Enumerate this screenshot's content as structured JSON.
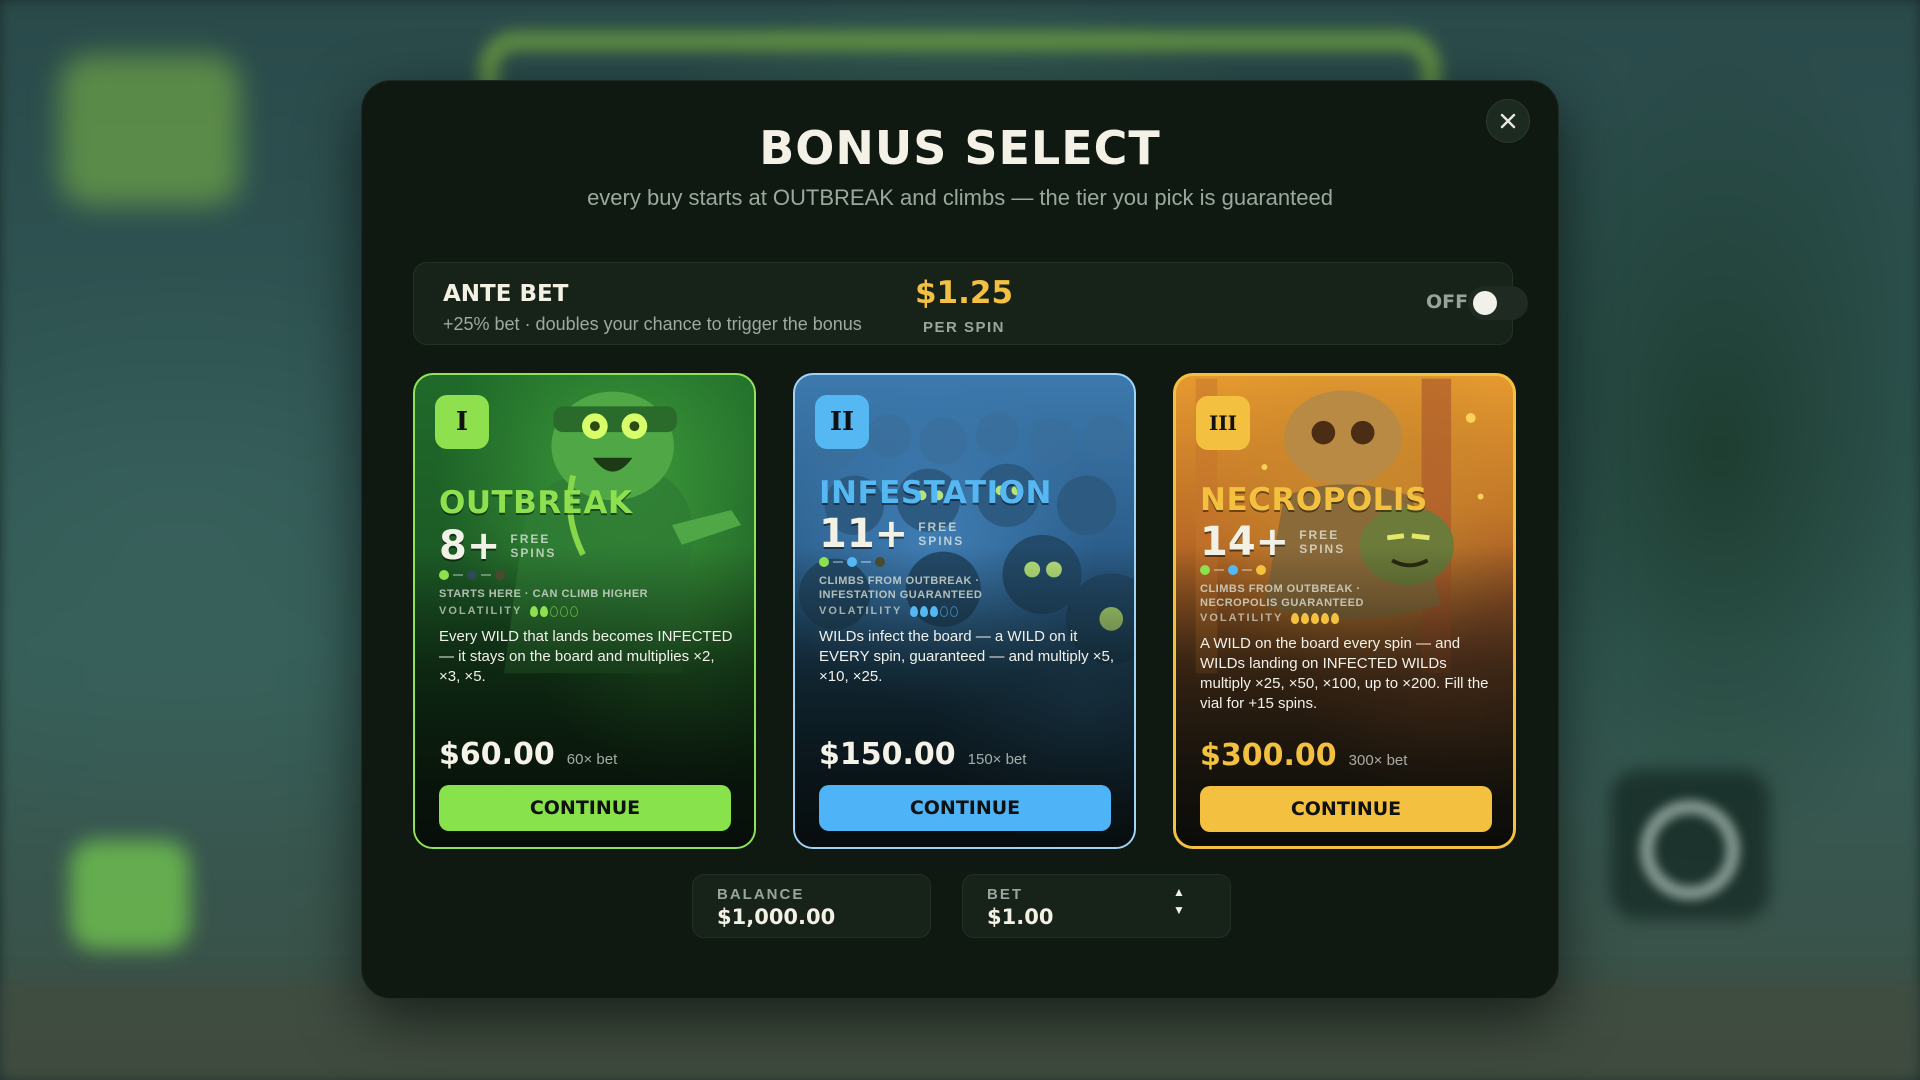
{
  "modal": {
    "title": "BONUS SELECT",
    "subtitle": "every buy starts at OUTBREAK and climbs — the tier you pick is guaranteed",
    "close_icon": "close-icon"
  },
  "ante": {
    "title": "ANTE BET",
    "description": "+25% bet · doubles your chance to trigger the bonus",
    "price": "$1.25",
    "per_label": "PER SPIN",
    "state_label": "OFF",
    "enabled": false
  },
  "cards": [
    {
      "tier": "I",
      "name": "OUTBREAK",
      "spins": "8+",
      "spins_label": "FREE SPINS",
      "climb_text": "STARTS HERE · CAN CLIMB HIGHER",
      "volatility_label": "VOLATILITY",
      "volatility": 2,
      "volatility_max": 5,
      "description": "Every WILD that lands becomes INFECTED — it stays on the board and multiplies ×2, ×3, ×5.",
      "price": "$60.00",
      "multiplier": "60× bet",
      "button": "CONTINUE",
      "color": "#8ee04f"
    },
    {
      "tier": "II",
      "name": "INFESTATION",
      "spins": "11+",
      "spins_label": "FREE SPINS",
      "climb_text": "CLIMBS FROM OUTBREAK · INFESTATION GUARANTEED",
      "volatility_label": "VOLATILITY",
      "volatility": 3,
      "volatility_max": 5,
      "description": "WILDs infect the board — a WILD on it EVERY spin, guaranteed — and multiply ×5, ×10, ×25.",
      "price": "$150.00",
      "multiplier": "150× bet",
      "button": "CONTINUE",
      "color": "#55b8f3"
    },
    {
      "tier": "III",
      "name": "NECROPOLIS",
      "spins": "14+",
      "spins_label": "FREE SPINS",
      "climb_text": "CLIMBS FROM OUTBREAK · NECROPOLIS GUARANTEED",
      "volatility_label": "VOLATILITY",
      "volatility": 5,
      "volatility_max": 5,
      "description": "A WILD on the board every spin — and WILDs landing on INFECTED WILDs multiply ×25, ×50, ×100, up to ×200. Fill the vial for +15 spins.",
      "price": "$300.00",
      "multiplier": "300× bet",
      "button": "CONTINUE",
      "color": "#f3c13f"
    }
  ],
  "footer": {
    "balance_label": "BALANCE",
    "balance_value": "$1,000.00",
    "bet_label": "BET",
    "bet_value": "$1.00"
  }
}
